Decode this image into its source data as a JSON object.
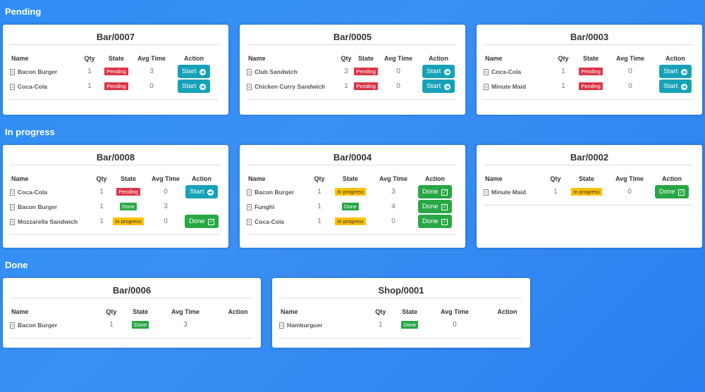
{
  "headers": {
    "name": "Name",
    "qty": "Qty",
    "state": "State",
    "avg": "Avg Time",
    "action": "Action"
  },
  "sections": {
    "pending": "Pending",
    "progress": "In progress",
    "done": "Done"
  },
  "labels": {
    "start": "Start",
    "done": "Done"
  },
  "cards": {
    "bar0007": {
      "title": "Bar/0007",
      "rows": [
        {
          "name": "Bacon Burger",
          "qty": "1",
          "state": "Pending",
          "avg": "3"
        },
        {
          "name": "Coca-Cola",
          "qty": "1",
          "state": "Pending",
          "avg": "0"
        }
      ]
    },
    "bar0005": {
      "title": "Bar/0005",
      "rows": [
        {
          "name": "Club Sandwich",
          "qty": "3",
          "state": "Pending",
          "avg": "0"
        },
        {
          "name": "Chicken Curry Sandwich",
          "qty": "1",
          "state": "Pending",
          "avg": "0"
        }
      ]
    },
    "bar0003": {
      "title": "Bar/0003",
      "rows": [
        {
          "name": "Coca-Cola",
          "qty": "1",
          "state": "Pending",
          "avg": "0"
        },
        {
          "name": "Minute Maid",
          "qty": "1",
          "state": "Pending",
          "avg": "0"
        }
      ]
    },
    "bar0008": {
      "title": "Bar/0008",
      "rows": [
        {
          "name": "Coca-Cola",
          "qty": "1",
          "state": "Pending",
          "avg": "0"
        },
        {
          "name": "Bacon Burger",
          "qty": "1",
          "state": "Done",
          "avg": "3"
        },
        {
          "name": "Mozzarella Sandwich",
          "qty": "1",
          "state": "In progress",
          "avg": "0"
        }
      ]
    },
    "bar0004": {
      "title": "Bar/0004",
      "rows": [
        {
          "name": "Bacon Burger",
          "qty": "1",
          "state": "In progress",
          "avg": "3"
        },
        {
          "name": "Funghi",
          "qty": "1",
          "state": "Done",
          "avg": "4"
        },
        {
          "name": "Coca-Cola",
          "qty": "1",
          "state": "In progress",
          "avg": "0"
        }
      ]
    },
    "bar0002": {
      "title": "Bar/0002",
      "rows": [
        {
          "name": "Minute Maid",
          "qty": "1",
          "state": "In progress",
          "avg": "0"
        }
      ]
    },
    "bar0006": {
      "title": "Bar/0006",
      "rows": [
        {
          "name": "Bacon Burger",
          "qty": "1",
          "state": "Done",
          "avg": "3"
        }
      ]
    },
    "shop0001": {
      "title": "Shop/0001",
      "rows": [
        {
          "name": "Hamburguer",
          "qty": "1",
          "state": "Done",
          "avg": "0"
        }
      ]
    }
  }
}
